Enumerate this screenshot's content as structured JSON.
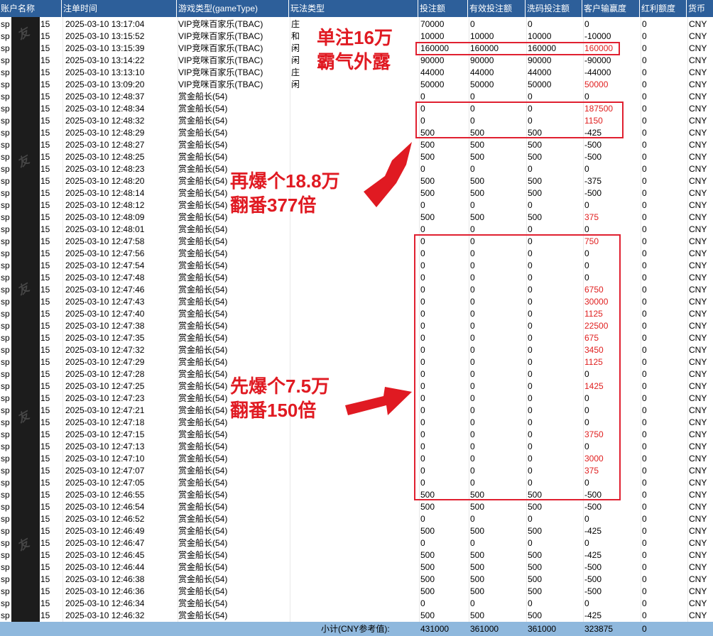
{
  "columns": [
    "账户名称",
    "注单时间",
    "游戏类型(gameType)",
    "玩法类型",
    "投注额",
    "有效投注额",
    "洗码投注额",
    "客户输赢度",
    "红利额度",
    "货币"
  ],
  "rows": [
    {
      "account": "sp",
      "id": "15",
      "time": "2025-03-10 13:17:04",
      "game": "VIP竞咪百家乐(TBAC)",
      "play": "庄",
      "bet": "70000",
      "valid": "0",
      "wash": "0",
      "win": "0",
      "bonus": "0",
      "cur": "CNY"
    },
    {
      "account": "sp",
      "id": "15",
      "time": "2025-03-10 13:15:52",
      "game": "VIP竞咪百家乐(TBAC)",
      "play": "和",
      "bet": "10000",
      "valid": "10000",
      "wash": "10000",
      "win": "-10000",
      "bonus": "0",
      "cur": "CNY"
    },
    {
      "account": "sp",
      "id": "15",
      "time": "2025-03-10 13:15:39",
      "game": "VIP竞咪百家乐(TBAC)",
      "play": "闲",
      "bet": "160000",
      "valid": "160000",
      "wash": "160000",
      "win": "160000",
      "bonus": "0",
      "cur": "CNY"
    },
    {
      "account": "sp",
      "id": "15",
      "time": "2025-03-10 13:14:22",
      "game": "VIP竞咪百家乐(TBAC)",
      "play": "闲",
      "bet": "90000",
      "valid": "90000",
      "wash": "90000",
      "win": "-90000",
      "bonus": "0",
      "cur": "CNY"
    },
    {
      "account": "sp",
      "id": "15",
      "time": "2025-03-10 13:13:10",
      "game": "VIP竞咪百家乐(TBAC)",
      "play": "庄",
      "bet": "44000",
      "valid": "44000",
      "wash": "44000",
      "win": "-44000",
      "bonus": "0",
      "cur": "CNY"
    },
    {
      "account": "sp",
      "id": "15",
      "time": "2025-03-10 13:09:20",
      "game": "VIP竞咪百家乐(TBAC)",
      "play": "闲",
      "bet": "50000",
      "valid": "50000",
      "wash": "50000",
      "win": "50000",
      "bonus": "0",
      "cur": "CNY"
    },
    {
      "account": "sp",
      "id": "15",
      "time": "2025-03-10 12:48:37",
      "game": "赏金船长(54)",
      "play": "",
      "bet": "0",
      "valid": "0",
      "wash": "0",
      "win": "0",
      "bonus": "0",
      "cur": "CNY"
    },
    {
      "account": "sp",
      "id": "15",
      "time": "2025-03-10 12:48:34",
      "game": "赏金船长(54)",
      "play": "",
      "bet": "0",
      "valid": "0",
      "wash": "0",
      "win": "187500",
      "bonus": "0",
      "cur": "CNY"
    },
    {
      "account": "sp",
      "id": "15",
      "time": "2025-03-10 12:48:32",
      "game": "赏金船长(54)",
      "play": "",
      "bet": "0",
      "valid": "0",
      "wash": "0",
      "win": "1150",
      "bonus": "0",
      "cur": "CNY"
    },
    {
      "account": "sp",
      "id": "15",
      "time": "2025-03-10 12:48:29",
      "game": "赏金船长(54)",
      "play": "",
      "bet": "500",
      "valid": "500",
      "wash": "500",
      "win": "-425",
      "bonus": "0",
      "cur": "CNY"
    },
    {
      "account": "sp",
      "id": "15",
      "time": "2025-03-10 12:48:27",
      "game": "赏金船长(54)",
      "play": "",
      "bet": "500",
      "valid": "500",
      "wash": "500",
      "win": "-500",
      "bonus": "0",
      "cur": "CNY"
    },
    {
      "account": "sp",
      "id": "15",
      "time": "2025-03-10 12:48:25",
      "game": "赏金船长(54)",
      "play": "",
      "bet": "500",
      "valid": "500",
      "wash": "500",
      "win": "-500",
      "bonus": "0",
      "cur": "CNY"
    },
    {
      "account": "sp",
      "id": "15",
      "time": "2025-03-10 12:48:23",
      "game": "赏金船长(54)",
      "play": "",
      "bet": "0",
      "valid": "0",
      "wash": "0",
      "win": "0",
      "bonus": "0",
      "cur": "CNY"
    },
    {
      "account": "sp",
      "id": "15",
      "time": "2025-03-10 12:48:20",
      "game": "赏金船长(54)",
      "play": "",
      "bet": "500",
      "valid": "500",
      "wash": "500",
      "win": "-375",
      "bonus": "0",
      "cur": "CNY"
    },
    {
      "account": "sp",
      "id": "15",
      "time": "2025-03-10 12:48:14",
      "game": "赏金船长(54)",
      "play": "",
      "bet": "500",
      "valid": "500",
      "wash": "500",
      "win": "-500",
      "bonus": "0",
      "cur": "CNY"
    },
    {
      "account": "sp",
      "id": "15",
      "time": "2025-03-10 12:48:12",
      "game": "赏金船长(54)",
      "play": "",
      "bet": "0",
      "valid": "0",
      "wash": "0",
      "win": "0",
      "bonus": "0",
      "cur": "CNY"
    },
    {
      "account": "sp",
      "id": "15",
      "time": "2025-03-10 12:48:09",
      "game": "赏金船长(54)",
      "play": "",
      "bet": "500",
      "valid": "500",
      "wash": "500",
      "win": "375",
      "bonus": "0",
      "cur": "CNY"
    },
    {
      "account": "sp",
      "id": "15",
      "time": "2025-03-10 12:48:01",
      "game": "赏金船长(54)",
      "play": "",
      "bet": "0",
      "valid": "0",
      "wash": "0",
      "win": "0",
      "bonus": "0",
      "cur": "CNY"
    },
    {
      "account": "sp",
      "id": "15",
      "time": "2025-03-10 12:47:58",
      "game": "赏金船长(54)",
      "play": "",
      "bet": "0",
      "valid": "0",
      "wash": "0",
      "win": "750",
      "bonus": "0",
      "cur": "CNY"
    },
    {
      "account": "sp",
      "id": "15",
      "time": "2025-03-10 12:47:56",
      "game": "赏金船长(54)",
      "play": "",
      "bet": "0",
      "valid": "0",
      "wash": "0",
      "win": "0",
      "bonus": "0",
      "cur": "CNY"
    },
    {
      "account": "sp",
      "id": "15",
      "time": "2025-03-10 12:47:54",
      "game": "赏金船长(54)",
      "play": "",
      "bet": "0",
      "valid": "0",
      "wash": "0",
      "win": "0",
      "bonus": "0",
      "cur": "CNY"
    },
    {
      "account": "sp",
      "id": "15",
      "time": "2025-03-10 12:47:48",
      "game": "赏金船长(54)",
      "play": "",
      "bet": "0",
      "valid": "0",
      "wash": "0",
      "win": "0",
      "bonus": "0",
      "cur": "CNY"
    },
    {
      "account": "sp",
      "id": "15",
      "time": "2025-03-10 12:47:46",
      "game": "赏金船长(54)",
      "play": "",
      "bet": "0",
      "valid": "0",
      "wash": "0",
      "win": "6750",
      "bonus": "0",
      "cur": "CNY"
    },
    {
      "account": "sp",
      "id": "15",
      "time": "2025-03-10 12:47:43",
      "game": "赏金船长(54)",
      "play": "",
      "bet": "0",
      "valid": "0",
      "wash": "0",
      "win": "30000",
      "bonus": "0",
      "cur": "CNY"
    },
    {
      "account": "sp",
      "id": "15",
      "time": "2025-03-10 12:47:40",
      "game": "赏金船长(54)",
      "play": "",
      "bet": "0",
      "valid": "0",
      "wash": "0",
      "win": "1125",
      "bonus": "0",
      "cur": "CNY"
    },
    {
      "account": "sp",
      "id": "15",
      "time": "2025-03-10 12:47:38",
      "game": "赏金船长(54)",
      "play": "",
      "bet": "0",
      "valid": "0",
      "wash": "0",
      "win": "22500",
      "bonus": "0",
      "cur": "CNY"
    },
    {
      "account": "sp",
      "id": "15",
      "time": "2025-03-10 12:47:35",
      "game": "赏金船长(54)",
      "play": "",
      "bet": "0",
      "valid": "0",
      "wash": "0",
      "win": "675",
      "bonus": "0",
      "cur": "CNY"
    },
    {
      "account": "sp",
      "id": "15",
      "time": "2025-03-10 12:47:32",
      "game": "赏金船长(54)",
      "play": "",
      "bet": "0",
      "valid": "0",
      "wash": "0",
      "win": "3450",
      "bonus": "0",
      "cur": "CNY"
    },
    {
      "account": "sp",
      "id": "15",
      "time": "2025-03-10 12:47:29",
      "game": "赏金船长(54)",
      "play": "",
      "bet": "0",
      "valid": "0",
      "wash": "0",
      "win": "1125",
      "bonus": "0",
      "cur": "CNY"
    },
    {
      "account": "sp",
      "id": "15",
      "time": "2025-03-10 12:47:28",
      "game": "赏金船长(54)",
      "play": "",
      "bet": "0",
      "valid": "0",
      "wash": "0",
      "win": "0",
      "bonus": "0",
      "cur": "CNY"
    },
    {
      "account": "sp",
      "id": "15",
      "time": "2025-03-10 12:47:25",
      "game": "赏金船长(54)",
      "play": "",
      "bet": "0",
      "valid": "0",
      "wash": "0",
      "win": "1425",
      "bonus": "0",
      "cur": "CNY"
    },
    {
      "account": "sp",
      "id": "15",
      "time": "2025-03-10 12:47:23",
      "game": "赏金船长(54)",
      "play": "",
      "bet": "0",
      "valid": "0",
      "wash": "0",
      "win": "0",
      "bonus": "0",
      "cur": "CNY"
    },
    {
      "account": "sp",
      "id": "15",
      "time": "2025-03-10 12:47:21",
      "game": "赏金船长(54)",
      "play": "",
      "bet": "0",
      "valid": "0",
      "wash": "0",
      "win": "0",
      "bonus": "0",
      "cur": "CNY"
    },
    {
      "account": "sp",
      "id": "15",
      "time": "2025-03-10 12:47:18",
      "game": "赏金船长(54)",
      "play": "",
      "bet": "0",
      "valid": "0",
      "wash": "0",
      "win": "0",
      "bonus": "0",
      "cur": "CNY"
    },
    {
      "account": "sp",
      "id": "15",
      "time": "2025-03-10 12:47:15",
      "game": "赏金船长(54)",
      "play": "",
      "bet": "0",
      "valid": "0",
      "wash": "0",
      "win": "3750",
      "bonus": "0",
      "cur": "CNY"
    },
    {
      "account": "sp",
      "id": "15",
      "time": "2025-03-10 12:47:13",
      "game": "赏金船长(54)",
      "play": "",
      "bet": "0",
      "valid": "0",
      "wash": "0",
      "win": "0",
      "bonus": "0",
      "cur": "CNY"
    },
    {
      "account": "sp",
      "id": "15",
      "time": "2025-03-10 12:47:10",
      "game": "赏金船长(54)",
      "play": "",
      "bet": "0",
      "valid": "0",
      "wash": "0",
      "win": "3000",
      "bonus": "0",
      "cur": "CNY"
    },
    {
      "account": "sp",
      "id": "15",
      "time": "2025-03-10 12:47:07",
      "game": "赏金船长(54)",
      "play": "",
      "bet": "0",
      "valid": "0",
      "wash": "0",
      "win": "375",
      "bonus": "0",
      "cur": "CNY"
    },
    {
      "account": "sp",
      "id": "15",
      "time": "2025-03-10 12:47:05",
      "game": "赏金船长(54)",
      "play": "",
      "bet": "0",
      "valid": "0",
      "wash": "0",
      "win": "0",
      "bonus": "0",
      "cur": "CNY"
    },
    {
      "account": "sp",
      "id": "15",
      "time": "2025-03-10 12:46:55",
      "game": "赏金船长(54)",
      "play": "",
      "bet": "500",
      "valid": "500",
      "wash": "500",
      "win": "-500",
      "bonus": "0",
      "cur": "CNY"
    },
    {
      "account": "sp",
      "id": "15",
      "time": "2025-03-10 12:46:54",
      "game": "赏金船长(54)",
      "play": "",
      "bet": "500",
      "valid": "500",
      "wash": "500",
      "win": "-500",
      "bonus": "0",
      "cur": "CNY"
    },
    {
      "account": "sp",
      "id": "15",
      "time": "2025-03-10 12:46:52",
      "game": "赏金船长(54)",
      "play": "",
      "bet": "0",
      "valid": "0",
      "wash": "0",
      "win": "0",
      "bonus": "0",
      "cur": "CNY"
    },
    {
      "account": "sp",
      "id": "15",
      "time": "2025-03-10 12:46:49",
      "game": "赏金船长(54)",
      "play": "",
      "bet": "500",
      "valid": "500",
      "wash": "500",
      "win": "-425",
      "bonus": "0",
      "cur": "CNY"
    },
    {
      "account": "sp",
      "id": "15",
      "time": "2025-03-10 12:46:47",
      "game": "赏金船长(54)",
      "play": "",
      "bet": "0",
      "valid": "0",
      "wash": "0",
      "win": "0",
      "bonus": "0",
      "cur": "CNY"
    },
    {
      "account": "sp",
      "id": "15",
      "time": "2025-03-10 12:46:45",
      "game": "赏金船长(54)",
      "play": "",
      "bet": "500",
      "valid": "500",
      "wash": "500",
      "win": "-425",
      "bonus": "0",
      "cur": "CNY"
    },
    {
      "account": "sp",
      "id": "15",
      "time": "2025-03-10 12:46:44",
      "game": "赏金船长(54)",
      "play": "",
      "bet": "500",
      "valid": "500",
      "wash": "500",
      "win": "-500",
      "bonus": "0",
      "cur": "CNY"
    },
    {
      "account": "sp",
      "id": "15",
      "time": "2025-03-10 12:46:38",
      "game": "赏金船长(54)",
      "play": "",
      "bet": "500",
      "valid": "500",
      "wash": "500",
      "win": "-500",
      "bonus": "0",
      "cur": "CNY"
    },
    {
      "account": "sp",
      "id": "15",
      "time": "2025-03-10 12:46:36",
      "game": "赏金船长(54)",
      "play": "",
      "bet": "500",
      "valid": "500",
      "wash": "500",
      "win": "-500",
      "bonus": "0",
      "cur": "CNY"
    },
    {
      "account": "sp",
      "id": "15",
      "time": "2025-03-10 12:46:34",
      "game": "赏金船长(54)",
      "play": "",
      "bet": "0",
      "valid": "0",
      "wash": "0",
      "win": "0",
      "bonus": "0",
      "cur": "CNY"
    },
    {
      "account": "sp",
      "id": "15",
      "time": "2025-03-10 12:46:32",
      "game": "赏金船长(54)",
      "play": "",
      "bet": "500",
      "valid": "500",
      "wash": "500",
      "win": "-425",
      "bonus": "0",
      "cur": "CNY"
    }
  ],
  "red_win_values": [
    "160000",
    "50000",
    "187500",
    "1150",
    "375",
    "750",
    "6750",
    "30000",
    "1125",
    "22500",
    "675",
    "3450",
    "1425",
    "3750",
    "3000"
  ],
  "footer": {
    "label": "小计(CNY参考值):",
    "bet": "431000",
    "valid": "361000",
    "wash": "361000",
    "win": "323875",
    "bonus": "0"
  },
  "annotations": {
    "a1_line1": "单注16万",
    "a1_line2": "霸气外露",
    "a2_line1": "再爆个18.8万",
    "a2_line2": "翻番377倍",
    "a3_line1": "先爆个7.5万",
    "a3_line2": "翻番150倍"
  },
  "watermark_text": "友",
  "colors": {
    "header_bg": "#2d5f9a",
    "footer_bg": "#8fb8dd",
    "highlight_red": "#e02030",
    "annotation_red": "#e01a22"
  }
}
